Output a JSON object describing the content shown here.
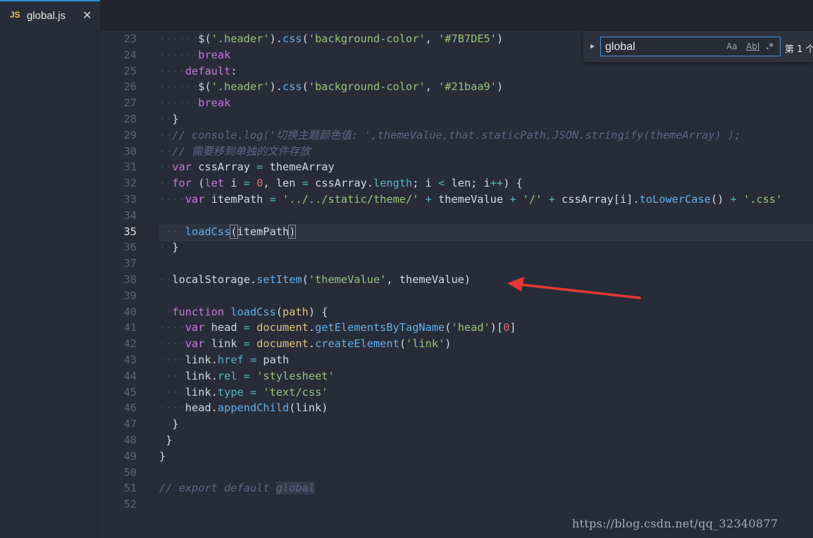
{
  "tab": {
    "badge": "JS",
    "title": "global.js",
    "close": "✕"
  },
  "find": {
    "value": "global",
    "opt_case": "Aa",
    "opt_word": "Abl",
    "opt_regex": ".*",
    "count": "第 1 个"
  },
  "watermark": "https://blog.csdn.net/qq_32340877",
  "colors": {
    "accent": "#2b8fd6",
    "arrow": "#e53935",
    "background": "#282c38"
  },
  "lines": [
    {
      "n": "23",
      "segs": [
        [
          "ind",
          "······"
        ],
        [
          "",
          "$("
        ],
        [
          "str",
          "'.header'"
        ],
        [
          "",
          ")."
        ],
        [
          "fn",
          "css"
        ],
        [
          "",
          "("
        ],
        [
          "str",
          "'background-color'"
        ],
        [
          "",
          ", "
        ],
        [
          "str",
          "'#7B7DE5'"
        ],
        [
          "",
          ")"
        ]
      ]
    },
    {
      "n": "24",
      "segs": [
        [
          "ind",
          "······"
        ],
        [
          "kw",
          "break"
        ]
      ]
    },
    {
      "n": "25",
      "segs": [
        [
          "ind",
          "····"
        ],
        [
          "kw",
          "default"
        ],
        [
          "",
          ":"
        ]
      ]
    },
    {
      "n": "26",
      "segs": [
        [
          "ind",
          "······"
        ],
        [
          "",
          "$("
        ],
        [
          "str",
          "'.header'"
        ],
        [
          "",
          ")."
        ],
        [
          "fn",
          "css"
        ],
        [
          "",
          "("
        ],
        [
          "str",
          "'background-color'"
        ],
        [
          "",
          ", "
        ],
        [
          "str",
          "'#21baa9'"
        ],
        [
          "",
          ")"
        ]
      ]
    },
    {
      "n": "27",
      "segs": [
        [
          "ind",
          "······"
        ],
        [
          "kw",
          "break"
        ]
      ]
    },
    {
      "n": "28",
      "segs": [
        [
          "ind",
          "··"
        ],
        [
          "",
          "}"
        ]
      ]
    },
    {
      "n": "29",
      "segs": [
        [
          "ind",
          "··"
        ],
        [
          "cmt",
          "// console.log('切换主题颜色值: ',themeValue,that.staticPath,JSON.stringify(themeArray) );"
        ]
      ]
    },
    {
      "n": "30",
      "segs": [
        [
          "ind",
          "··"
        ],
        [
          "cmt",
          "// 需要移到单独的文件存放"
        ]
      ]
    },
    {
      "n": "31",
      "segs": [
        [
          "ind",
          "··"
        ],
        [
          "kw",
          "var"
        ],
        [
          "",
          " cssArray "
        ],
        [
          "op",
          "="
        ],
        [
          "",
          " themeArray"
        ]
      ]
    },
    {
      "n": "32",
      "segs": [
        [
          "ind",
          "··"
        ],
        [
          "kw",
          "for"
        ],
        [
          "",
          " ("
        ],
        [
          "kw",
          "let"
        ],
        [
          "",
          " i "
        ],
        [
          "op",
          "="
        ],
        [
          "",
          ""
        ],
        [
          "num",
          " 0"
        ],
        [
          "",
          ", len "
        ],
        [
          "op",
          "="
        ],
        [
          "",
          " cssArray."
        ],
        [
          "prop",
          "length"
        ],
        [
          "",
          "; i "
        ],
        [
          "op",
          "<"
        ],
        [
          "",
          " len; i"
        ],
        [
          "op",
          "++"
        ],
        [
          "",
          ") {"
        ]
      ]
    },
    {
      "n": "33",
      "segs": [
        [
          "ind",
          "····"
        ],
        [
          "kw",
          "var"
        ],
        [
          "",
          " itemPath "
        ],
        [
          "op",
          "="
        ],
        [
          " ",
          ""
        ],
        [
          "str",
          " '../../static/theme/'"
        ],
        [
          "op",
          " +"
        ],
        [
          "",
          " themeValue "
        ],
        [
          "op",
          "+"
        ],
        [
          "str",
          " '/'"
        ],
        [
          "op",
          " +"
        ],
        [
          "",
          " cssArray[i]."
        ],
        [
          "fn",
          "toLowerCase"
        ],
        [
          "",
          "() "
        ],
        [
          "op",
          "+"
        ],
        [
          "str",
          " '.css'"
        ]
      ]
    },
    {
      "n": "34",
      "segs": []
    },
    {
      "n": "35",
      "segs": [
        [
          "ind",
          "····"
        ],
        [
          "fn",
          "loadCss"
        ],
        [
          "br",
          "("
        ],
        [
          "",
          "itemPath"
        ],
        [
          "br",
          ")"
        ]
      ]
    },
    {
      "n": "36",
      "segs": [
        [
          "ind",
          "··"
        ],
        [
          "",
          "}"
        ]
      ]
    },
    {
      "n": "37",
      "segs": []
    },
    {
      "n": "38",
      "segs": [
        [
          "ind",
          "··"
        ],
        [
          "",
          "localStorage."
        ],
        [
          "fn",
          "setItem"
        ],
        [
          "",
          "("
        ],
        [
          "str",
          "'themeValue'"
        ],
        [
          "",
          ", themeValue)"
        ]
      ]
    },
    {
      "n": "39",
      "segs": []
    },
    {
      "n": "40",
      "segs": [
        [
          "ind",
          "··"
        ],
        [
          "kw",
          "function"
        ],
        [
          "",
          " "
        ],
        [
          "fn",
          "loadCss"
        ],
        [
          "",
          "("
        ],
        [
          "obj",
          "path"
        ],
        [
          "",
          ") {"
        ]
      ]
    },
    {
      "n": "41",
      "segs": [
        [
          "ind",
          "····"
        ],
        [
          "kw",
          "var"
        ],
        [
          "",
          " head "
        ],
        [
          "op",
          "="
        ],
        [
          "obj",
          " document"
        ],
        [
          "",
          "."
        ],
        [
          "fn",
          "getElementsByTagName"
        ],
        [
          "",
          "("
        ],
        [
          "str",
          "'head'"
        ],
        [
          "",
          ")["
        ],
        [
          "num",
          "0"
        ],
        [
          "",
          "]"
        ]
      ]
    },
    {
      "n": "42",
      "segs": [
        [
          "ind",
          "····"
        ],
        [
          "kw",
          "var"
        ],
        [
          "",
          " link "
        ],
        [
          "op",
          "="
        ],
        [
          "obj",
          " document"
        ],
        [
          "",
          "."
        ],
        [
          "fn",
          "createElement"
        ],
        [
          "",
          "("
        ],
        [
          "str",
          "'link'"
        ],
        [
          "",
          ")"
        ]
      ]
    },
    {
      "n": "43",
      "segs": [
        [
          "ind",
          "····"
        ],
        [
          "",
          "link."
        ],
        [
          "prop",
          "href"
        ],
        [
          "",
          " "
        ],
        [
          "op",
          "="
        ],
        [
          "",
          " path"
        ]
      ]
    },
    {
      "n": "44",
      "segs": [
        [
          "ind",
          "····"
        ],
        [
          "",
          "link."
        ],
        [
          "prop",
          "rel"
        ],
        [
          "",
          " "
        ],
        [
          "op",
          "="
        ],
        [
          "str",
          " 'stylesheet'"
        ]
      ]
    },
    {
      "n": "45",
      "segs": [
        [
          "ind",
          "····"
        ],
        [
          "",
          "link."
        ],
        [
          "prop",
          "type"
        ],
        [
          "",
          " "
        ],
        [
          "op",
          "="
        ],
        [
          "str",
          " 'text/css'"
        ]
      ]
    },
    {
      "n": "46",
      "segs": [
        [
          "ind",
          "····"
        ],
        [
          "",
          "head."
        ],
        [
          "fn",
          "appendChild"
        ],
        [
          "",
          "(link)"
        ]
      ]
    },
    {
      "n": "47",
      "segs": [
        [
          "ind",
          "··"
        ],
        [
          "",
          "}"
        ]
      ]
    },
    {
      "n": "48",
      "segs": [
        [
          "ind",
          " "
        ],
        [
          "",
          "}"
        ]
      ]
    },
    {
      "n": "49",
      "segs": [
        [
          "",
          "}"
        ]
      ]
    },
    {
      "n": "50",
      "segs": []
    },
    {
      "n": "51",
      "segs": [
        [
          "cmt",
          "// export default "
        ],
        [
          "cmt sel",
          "global"
        ]
      ]
    },
    {
      "n": "52",
      "segs": []
    }
  ]
}
